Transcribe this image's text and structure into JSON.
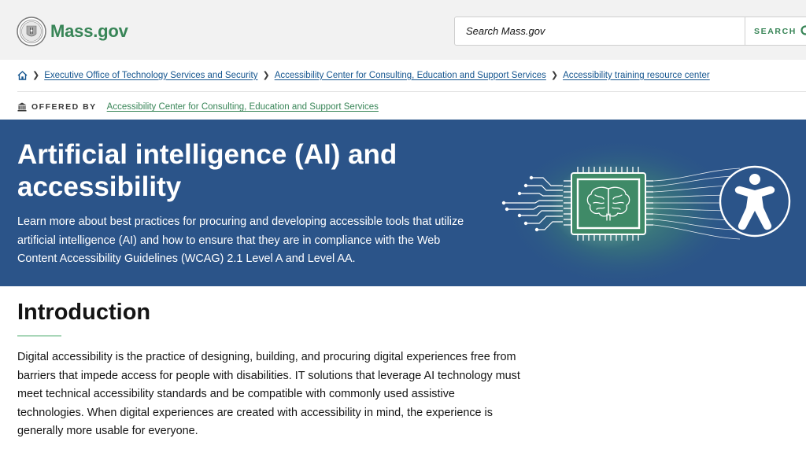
{
  "header": {
    "logo_text": "Mass.gov",
    "search_placeholder": "Search Mass.gov",
    "search_button": "SEARCH"
  },
  "breadcrumb": {
    "items": [
      "Executive Office of Technology Services and Security",
      "Accessibility Center for Consulting, Education and Support Services",
      "Accessibility training resource center"
    ]
  },
  "offered_by": {
    "label": "OFFERED BY",
    "org": "Accessibility Center for Consulting, Education and Support Services"
  },
  "hero": {
    "title": "Artificial intelligence (AI) and accessibility",
    "description": "Learn more about best practices for procuring and developing accessible tools that utilize artificial intelligence (AI) and how to ensure that they are in compliance with the Web Content Accessibility Guidelines (WCAG) 2.1 Level A and Level AA."
  },
  "intro": {
    "heading": "Introduction",
    "body": "Digital accessibility is the practice of designing, building, and procuring digital experiences free from barriers that impede access for people with disabilities. IT solutions that leverage AI technology must meet technical accessibility standards and be compatible with commonly used assistive technologies. When digital experiences are created with accessibility in mind, the experience is generally more usable for everyone."
  },
  "colors": {
    "brand_green": "#388557",
    "link_blue": "#14558f",
    "hero_blue": "#2b5489",
    "header_bg": "#f2f2f2"
  },
  "icons": [
    "state-seal-icon",
    "search-icon",
    "home-icon",
    "chevron-right-icon",
    "building-icon",
    "ai-chip-brain-illustration",
    "accessibility-person-icon"
  ]
}
